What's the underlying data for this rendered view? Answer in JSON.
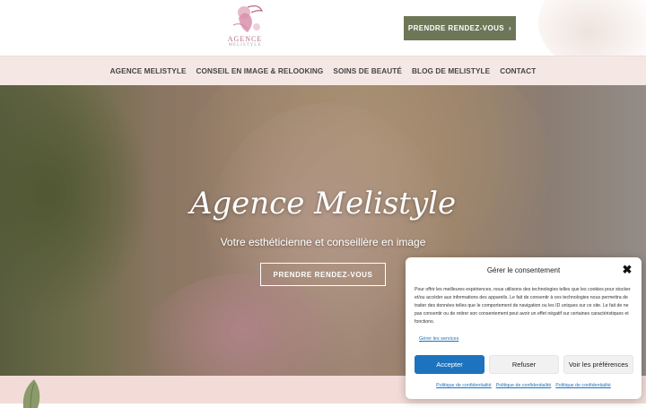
{
  "header": {
    "logo_text": "AGENCE",
    "logo_sub": "MELISTYLE",
    "cta_label": "PRENDRE RENDEZ-VOUS",
    "cta_chevron": "›"
  },
  "nav": {
    "items": [
      {
        "label": "AGENCE MELISTYLE"
      },
      {
        "label": "CONSEIL EN IMAGE & RELOOKING"
      },
      {
        "label": "SOINS DE BEAUTÉ"
      },
      {
        "label": "BLOG DE MELISTYLE"
      },
      {
        "label": "CONTACT"
      }
    ]
  },
  "hero": {
    "title": "Agence Melistyle",
    "subtitle": "Votre esthéticienne et conseillère en image",
    "button_label": "PRENDRE RENDEZ-VOUS"
  },
  "consent": {
    "title": "Gérer le consentement",
    "close_glyph": "✖",
    "body": "Pour offrir les meilleures expériences, nous utilisons des technologies telles que les cookies pour stocker et/ou accéder aux informations des appareils. Le fait de consentir à ces technologies nous permettra de traiter des données telles que le comportement de navigation ou les ID uniques sur ce site. Le fait de ne pas consentir ou de retirer son consentement peut avoir un effet négatif sur certaines caractéristiques et fonctions.",
    "manage_label": "Gérer les services",
    "accept_label": "Accepter",
    "refuse_label": "Refuser",
    "prefs_label": "Voir les préférences",
    "links": [
      {
        "label": "Politique de confidentialité"
      },
      {
        "label": "Politique de confidentialité"
      },
      {
        "label": "Politique de confidentialité"
      }
    ]
  },
  "colors": {
    "cta_green": "#6e7658",
    "nav_bg": "#f5e8e4",
    "link_blue": "#1e73be",
    "logo_pink": "#b36a86"
  },
  "icons": {
    "close": "close-icon",
    "chevron": "chevron-right-icon",
    "leaf": "leaf-icon"
  }
}
